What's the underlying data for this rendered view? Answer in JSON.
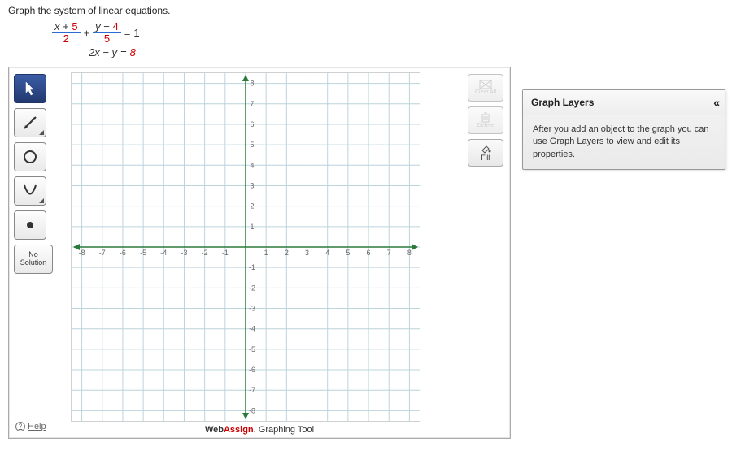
{
  "problem": {
    "instruction": "Graph the system of linear equations.",
    "eq1": {
      "frac1_num_a": "x",
      "frac1_num_op": " + ",
      "frac1_num_b": "5",
      "frac1_den": "2",
      "plus": " + ",
      "frac2_num_a": "y",
      "frac2_num_op": " − ",
      "frac2_num_b": "4",
      "frac2_den": "5",
      "eq": " = ",
      "rhs": "1"
    },
    "eq2": {
      "lhs": "2x − y",
      "eq": " = ",
      "rhs": "8"
    }
  },
  "tools": {
    "pointer": "pointer",
    "line": "line",
    "circle": "circle",
    "parabola": "parabola",
    "point": "point",
    "no_solution_line1": "No",
    "no_solution_line2": "Solution"
  },
  "side": {
    "clear": "Clear All",
    "delete": "Delete",
    "fill": "Fill"
  },
  "help": "Help",
  "brand": {
    "web": "Web",
    "assign": "Assign",
    "tool": ". Graphing Tool"
  },
  "layers": {
    "title": "Graph Layers",
    "collapse": "«",
    "body": "After you add an object to the graph you can use Graph Layers to view and edit its properties."
  },
  "axis": {
    "ticks_pos": [
      "1",
      "2",
      "3",
      "4",
      "5",
      "6",
      "7",
      "8"
    ],
    "ticks_neg": [
      "-1",
      "-2",
      "-3",
      "-4",
      "-5",
      "-6",
      "-7",
      "-8"
    ]
  },
  "chart_data": {
    "type": "scatter",
    "title": "",
    "xlabel": "",
    "ylabel": "",
    "xlim": [
      -8.5,
      8.5
    ],
    "ylim": [
      -8.5,
      8.5
    ],
    "grid": true,
    "series": []
  }
}
